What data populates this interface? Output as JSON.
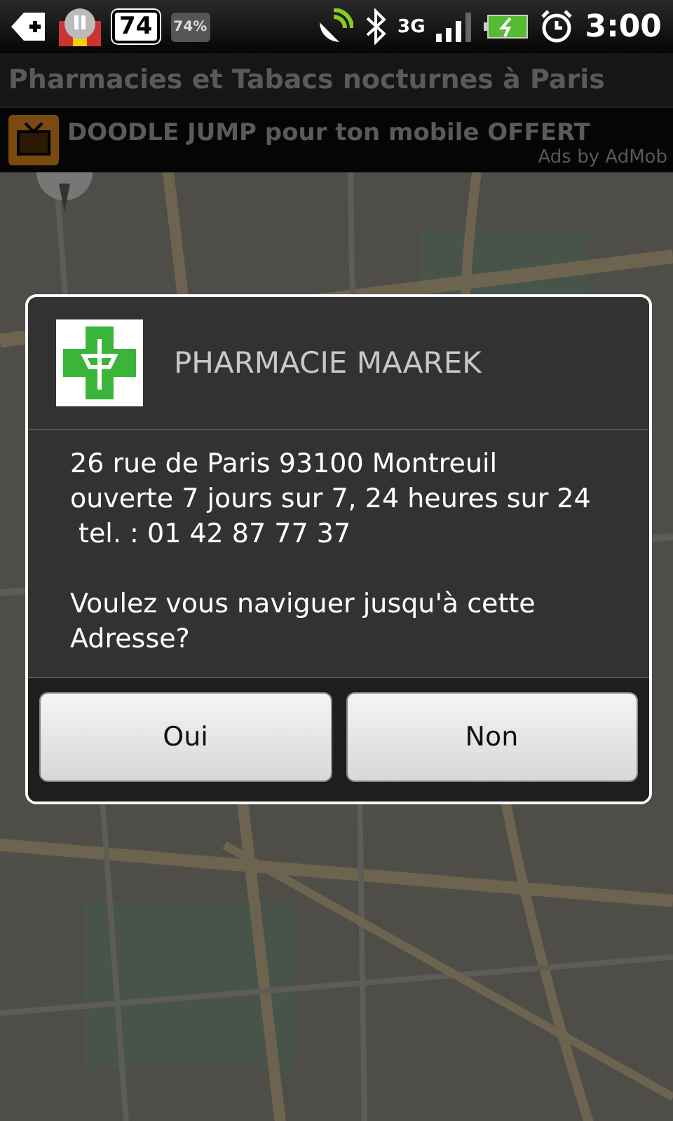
{
  "status_bar": {
    "badge": "74",
    "battery_widget": "74%",
    "network": "3G",
    "time": "3:00"
  },
  "app_bar": {
    "title": "Pharmacies et Tabacs nocturnes à Paris"
  },
  "ad": {
    "text": "DOODLE JUMP pour ton mobile OFFERT",
    "attribution": "Ads by AdMob"
  },
  "dialog": {
    "title": "PHARMACIE MAAREK",
    "message": "26 rue de Paris 93100 Montreuil\nouverte 7 jours sur 7, 24 heures sur 24\n tel. : 01 42 87 77 37\n\nVoulez vous naviguer jusqu'à cette Adresse?",
    "buttons": [
      "Oui",
      "Non"
    ]
  }
}
